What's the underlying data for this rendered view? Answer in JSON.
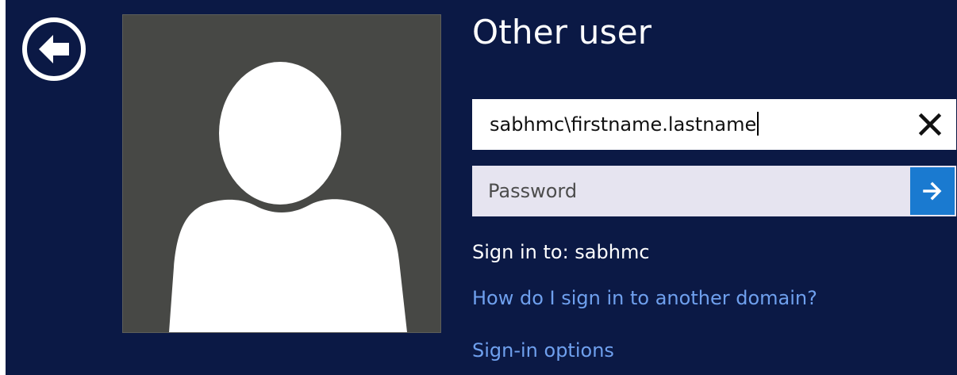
{
  "header": {
    "title": "Other user"
  },
  "back_button": {
    "icon": "back-arrow-icon"
  },
  "avatar": {
    "icon": "user-silhouette-icon"
  },
  "username": {
    "value": "sabhmc\\firstname.lastname",
    "clear_icon": "close-icon"
  },
  "password": {
    "placeholder": "Password",
    "submit_icon": "arrow-right-icon"
  },
  "signin_domain_text": "Sign in to: sabhmc",
  "links": {
    "other_domain": "How do I sign in to another domain?",
    "signin_options": "Sign-in options"
  },
  "colors": {
    "background": "#0b1945",
    "avatar_bg": "#474845",
    "accent": "#1a7ad0",
    "link": "#6fa0ee"
  }
}
